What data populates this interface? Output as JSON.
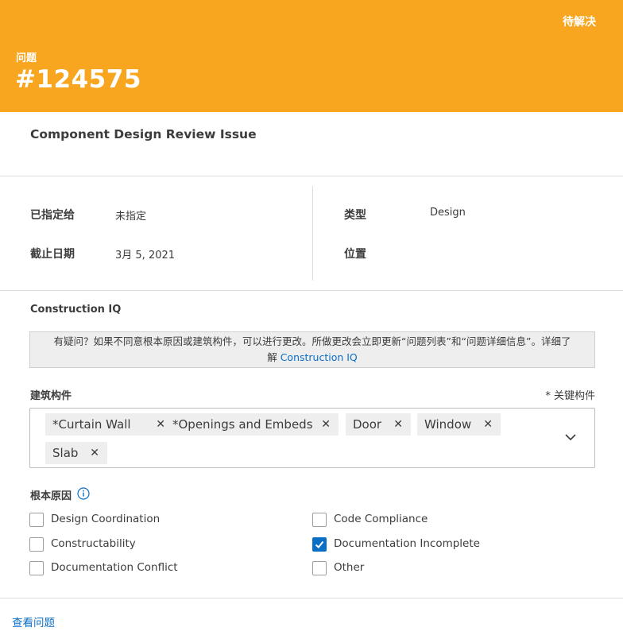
{
  "header": {
    "status": "待解决",
    "issue_label": "问题",
    "issue_number": "#124575"
  },
  "title": "Component Design Review Issue",
  "fields": {
    "assigned_label": "已指定给",
    "assigned_value": "未指定",
    "due_label": "截止日期",
    "due_value": "3月 5, 2021",
    "type_label": "类型",
    "type_value": "Design",
    "location_label": "位置"
  },
  "construction_iq": {
    "title": "Construction IQ",
    "notice_line1": "有疑问？如果不同意根本原因或建筑构件，可以进行更改。所做更改会立即更新“问题列表”和“问题详细信息”。详细了",
    "notice_line2_prefix": "解 ",
    "notice_link": "Construction IQ"
  },
  "building_components": {
    "label": "建筑构件",
    "key_note": "* 关键构件",
    "tags": [
      "*Curtain Wall",
      "*Openings and Embeds",
      "Door",
      "Window",
      "Slab"
    ],
    "remove_glyph": "✕"
  },
  "root_cause": {
    "label": "根本原因",
    "options": [
      {
        "label": "Design Coordination",
        "checked": false
      },
      {
        "label": "Code Compliance",
        "checked": false
      },
      {
        "label": "Constructability",
        "checked": false
      },
      {
        "label": "Documentation Incomplete",
        "checked": true
      },
      {
        "label": "Documentation Conflict",
        "checked": false
      },
      {
        "label": "Other",
        "checked": false
      }
    ]
  },
  "footer": {
    "view_issue": "查看问题"
  },
  "icons": {
    "info": "info-icon",
    "chevron": "chevron-down-icon",
    "check": "check-icon",
    "remove": "close-icon"
  },
  "colors": {
    "header_bg": "#f8a61f",
    "accent": "#0b6fc6",
    "tag_bg": "#eeeeee"
  }
}
